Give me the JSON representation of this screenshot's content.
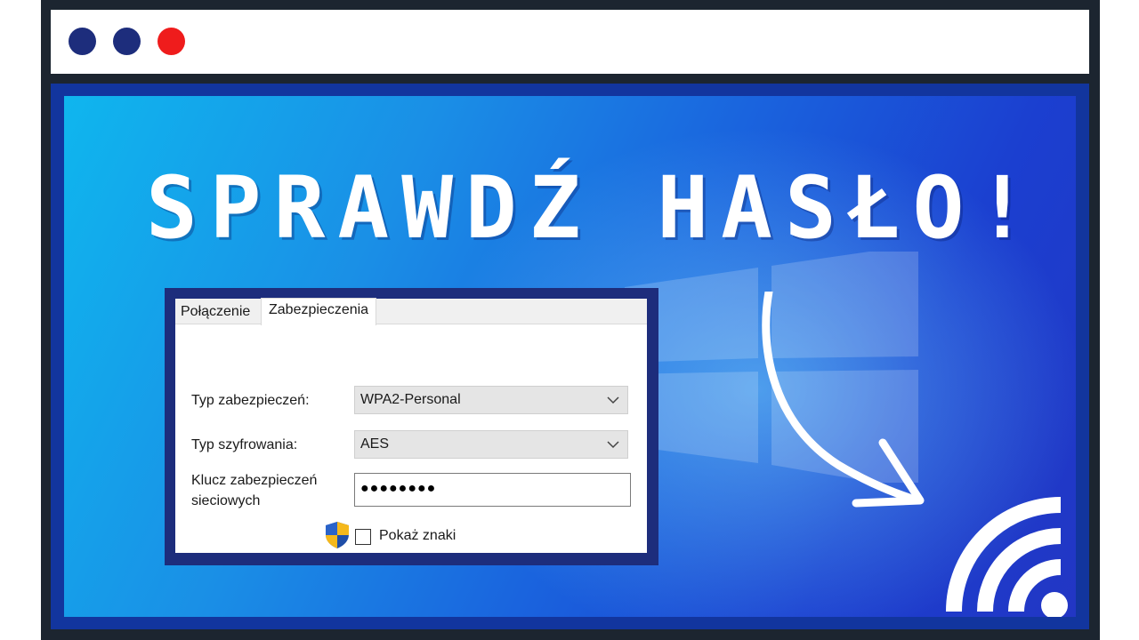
{
  "window": {
    "dots": [
      "#1d2d7c",
      "#1d2d7c",
      "#ef1c1c"
    ]
  },
  "headline": {
    "text": "SPRAWDŹ HASŁO!"
  },
  "dialog": {
    "tabs": [
      {
        "label": "Połączenie"
      },
      {
        "label": "Zabezpieczenia",
        "active": true
      }
    ],
    "security_type": {
      "label": "Typ zabezpieczeń:",
      "value": "WPA2-Personal"
    },
    "encryption_type": {
      "label": "Typ szyfrowania:",
      "value": "AES"
    },
    "network_key": {
      "label_line1": "Klucz zabezpieczeń",
      "label_line2": "sieciowych",
      "value": "●●●●●●●●"
    },
    "show_chars": {
      "label": "Pokaż znaki",
      "checked": false
    }
  },
  "icons": [
    "shield-icon",
    "chevron-down-icon",
    "curved-arrow-icon",
    "wifi-icon",
    "windows-logo-icon"
  ]
}
